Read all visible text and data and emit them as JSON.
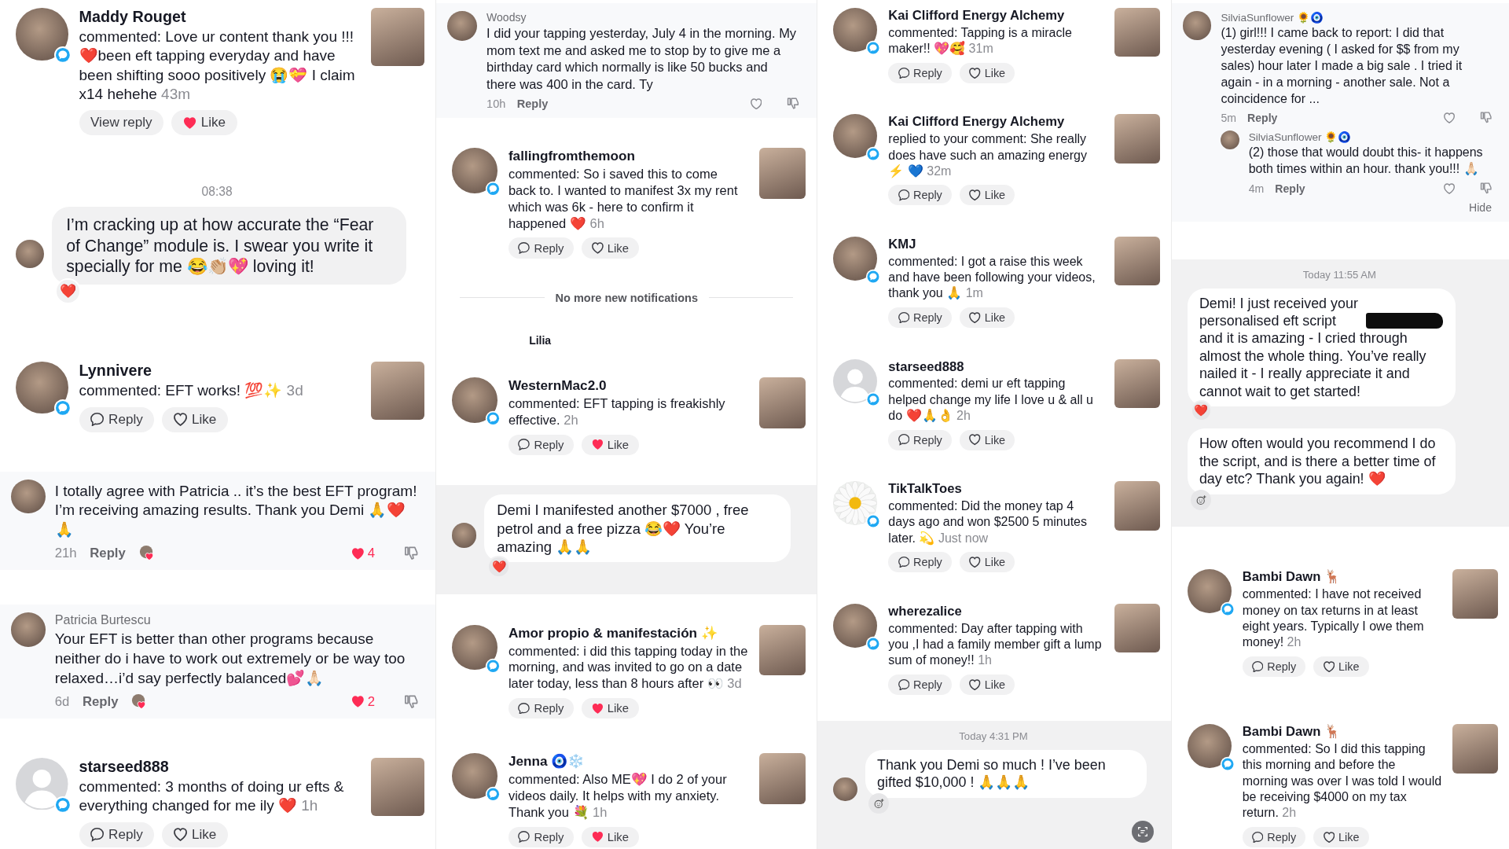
{
  "columns": [
    {
      "tiles": [
        {
          "kind": "notification",
          "avatar": {
            "kind": "photo"
          },
          "name": "Maddy Rouget",
          "text": "commented: Love ur content thank you !!! ❤️been eft tapping everyday and have been shifting sooo positively 😭💝 I claim x14 hehehe",
          "time": "43m",
          "actions": [
            {
              "kind": "view",
              "label": "View reply"
            },
            {
              "kind": "like",
              "label": "Like",
              "liked": true
            }
          ]
        },
        {
          "kind": "chat",
          "shaded": false,
          "timestamp": "08:38",
          "messages": [
            {
              "text": "I’m cracking up at how accurate the “Fear of Change” module is. I swear you write it specially for me 😂👏🏼💖 loving it!",
              "avatar": true,
              "reaction": "❤️"
            }
          ]
        },
        {
          "kind": "notification",
          "avatar": {
            "kind": "photo"
          },
          "name": "Lynnivere",
          "text": "commented: EFT works! 💯✨",
          "time": "3d",
          "actions": [
            {
              "kind": "reply",
              "label": "Reply"
            },
            {
              "kind": "like",
              "label": "Like",
              "liked": false
            }
          ]
        },
        {
          "kind": "comment",
          "text": "I totally agree with Patricia .. it’s the best EFT program! I’m receiving amazing results. Thank you Demi 🙏❤️🙏",
          "time": "21h",
          "reply": "Reply",
          "creator_liked": true,
          "likes": "4",
          "liked": true
        },
        {
          "kind": "comment",
          "name": "Patricia Burtescu",
          "text": "Your EFT is better than other programs because neither do i have to work out extremely or be way too relaxed…i’d say perfectly balanced💕🙏🏻",
          "time": "6d",
          "reply": "Reply",
          "creator_liked": true,
          "likes": "2",
          "liked": true
        },
        {
          "kind": "notification",
          "avatar": {
            "kind": "silhouette"
          },
          "name": "starseed888",
          "text": "commented: 3 months of doing ur efts & everything changed for me ily ❤️",
          "time": "1h",
          "actions": [
            {
              "kind": "reply",
              "label": "Reply"
            },
            {
              "kind": "like",
              "label": "Like",
              "liked": false
            }
          ]
        }
      ]
    },
    {
      "tiles": [
        {
          "kind": "comment",
          "name": "Woodsy",
          "text": "I did your tapping yesterday, July 4 in the morning. My mom text me and asked me to stop by to give me a birthday card which normally is like 50 bucks and there was 400 in the card. Ty",
          "time": "10h",
          "reply": "Reply",
          "creator_liked": false,
          "liked": false
        },
        {
          "kind": "notification",
          "avatar": {
            "kind": "photo"
          },
          "name": "fallingfromthemoon",
          "text": "commented: So i saved this to come back to. I wanted to manifest 3x my rent which was 6k - here to confirm it happened ❤️",
          "time": "6h",
          "actions": [
            {
              "kind": "reply",
              "label": "Reply"
            },
            {
              "kind": "like",
              "label": "Like",
              "liked": false
            }
          ]
        },
        {
          "kind": "divider",
          "label": "No more new notifications"
        },
        {
          "kind": "name_only",
          "name": "Lilia"
        },
        {
          "kind": "notification",
          "avatar": {
            "kind": "photo"
          },
          "name": "WesternMac2.0",
          "text": "commented: EFT tapping is freakishly effective.",
          "time": "2h",
          "actions": [
            {
              "kind": "reply",
              "label": "Reply"
            },
            {
              "kind": "like",
              "label": "Like",
              "liked": true
            }
          ]
        },
        {
          "kind": "chat",
          "shaded": true,
          "messages": [
            {
              "text": "Demi I manifested another $7000 , free petrol and a free pizza 😂❤️ You’re amazing 🙏🙏",
              "avatar": true,
              "reaction": "❤️"
            }
          ]
        },
        {
          "kind": "notification",
          "avatar": {
            "kind": "photo"
          },
          "name": "Amor propio & manifestación ✨",
          "text": "commented: i did this tapping today in the morning, and was invited to go on a date later today, less than 8 hours after 👀",
          "time": "3d",
          "actions": [
            {
              "kind": "reply",
              "label": "Reply"
            },
            {
              "kind": "like",
              "label": "Like",
              "liked": true
            }
          ]
        },
        {
          "kind": "notification",
          "avatar": {
            "kind": "photo"
          },
          "name": "Jenna 🧿❄️",
          "text": "commented: Also ME💖 I do 2 of your videos daily. It helps with my anxiety. Thank you 💐",
          "time": "1h",
          "actions": [
            {
              "kind": "reply",
              "label": "Reply"
            },
            {
              "kind": "like",
              "label": "Like",
              "liked": true
            }
          ]
        }
      ]
    },
    {
      "tiles": [
        {
          "kind": "notification",
          "avatar": {
            "kind": "photo"
          },
          "name": "Kai Clifford Energy Alchemy",
          "text": "commented: Tapping is a miracle maker!! 💖🥰",
          "time": "31m",
          "actions": [
            {
              "kind": "reply",
              "label": "Reply"
            },
            {
              "kind": "like",
              "label": "Like",
              "liked": false
            }
          ]
        },
        {
          "kind": "notification",
          "avatar": {
            "kind": "photo"
          },
          "name": "Kai Clifford Energy Alchemy",
          "text": "replied to your comment: She really does have such an amazing energy ⚡ 💙",
          "time": "32m",
          "actions": [
            {
              "kind": "reply",
              "label": "Reply"
            },
            {
              "kind": "like",
              "label": "Like",
              "liked": false
            }
          ]
        },
        {
          "kind": "notification",
          "avatar": {
            "kind": "photo"
          },
          "name": "KMJ",
          "text": "commented: I got a raise this week and have been following your videos, thank you 🙏",
          "time": "1m",
          "actions": [
            {
              "kind": "reply",
              "label": "Reply"
            },
            {
              "kind": "like",
              "label": "Like",
              "liked": false
            }
          ]
        },
        {
          "kind": "notification",
          "avatar": {
            "kind": "silhouette"
          },
          "name": "starseed888",
          "text": "commented: demi ur eft tapping helped change my life I love u & all u do ❤️🙏👌",
          "time": "2h",
          "actions": [
            {
              "kind": "reply",
              "label": "Reply"
            },
            {
              "kind": "like",
              "label": "Like",
              "liked": false
            }
          ]
        },
        {
          "kind": "notification",
          "avatar": {
            "kind": "flower"
          },
          "name": "TikTalkToes",
          "text": "commented: Did the money tap 4 days ago and won $2500 5 minutes later. 💫",
          "time": "Just now",
          "actions": [
            {
              "kind": "reply",
              "label": "Reply"
            },
            {
              "kind": "like",
              "label": "Like",
              "liked": false
            }
          ]
        },
        {
          "kind": "notification",
          "avatar": {
            "kind": "photo"
          },
          "name": "wherezalice",
          "text": "commented: Day after tapping with you ,I had a family member gift a lump sum of money!!",
          "time": "1h",
          "actions": [
            {
              "kind": "reply",
              "label": "Reply"
            },
            {
              "kind": "like",
              "label": "Like",
              "liked": false
            }
          ]
        },
        {
          "kind": "chat",
          "shaded": true,
          "timestamp": "Today 4:31 PM",
          "messages": [
            {
              "text": "Thank you Demi so much ! I’ve been gifted $10,000 ! 🙏🙏🙏",
              "avatar": true,
              "add_reaction": true
            }
          ],
          "scan_button": true
        }
      ]
    },
    {
      "tiles": [
        {
          "kind": "comment",
          "name": "SilviaSunflower 🌻🧿",
          "text": "(1) girl!!! I came back to report: I did that yesterday evening ( I asked for $$ from my sales) hour later I made a big sale . I tried it again - in a morning - another sale. Not a coincidence for ...",
          "time": "5m",
          "reply": "Reply",
          "creator_liked": false,
          "liked": false,
          "replies": [
            {
              "name": "SilviaSunflower 🌻🧿",
              "text": "(2) those that would doubt this- it happens both times within an hour. thank you!!! 🙏🏻",
              "time": "4m",
              "reply": "Reply",
              "creator_liked": false,
              "liked": false
            }
          ],
          "hide": "Hide"
        },
        {
          "kind": "chat",
          "shaded": true,
          "timestamp": "Today 11:55 AM",
          "messages": [
            {
              "text": "Demi! I just received your personalised eft script",
              "redacted": true,
              "text_after": "and it is amazing - I cried through almost the whole thing. You’ve really nailed it - I really appreciate it and cannot wait to get started!",
              "avatar": false,
              "reaction": "❤️"
            },
            {
              "text": "How often would you recommend I do the script, and is there a better time of day etc? Thank you again! ❤️",
              "avatar": false,
              "add_reaction": true
            }
          ]
        },
        {
          "kind": "notification",
          "avatar": {
            "kind": "photo"
          },
          "name": "Bambi Dawn 🦌",
          "text": "commented: I have not received money on tax returns in at least eight years. Typically I owe them money!",
          "time": "2h",
          "actions": [
            {
              "kind": "reply",
              "label": "Reply"
            },
            {
              "kind": "like",
              "label": "Like",
              "liked": false
            }
          ]
        },
        {
          "kind": "notification",
          "avatar": {
            "kind": "photo"
          },
          "name": "Bambi Dawn 🦌",
          "text": "commented: So I did this tapping this morning and before the morning was over I was told I would be receiving $4000 on my tax return.",
          "time": "2h",
          "actions": [
            {
              "kind": "reply",
              "label": "Reply"
            },
            {
              "kind": "like",
              "label": "Like",
              "liked": false
            }
          ]
        }
      ]
    }
  ]
}
